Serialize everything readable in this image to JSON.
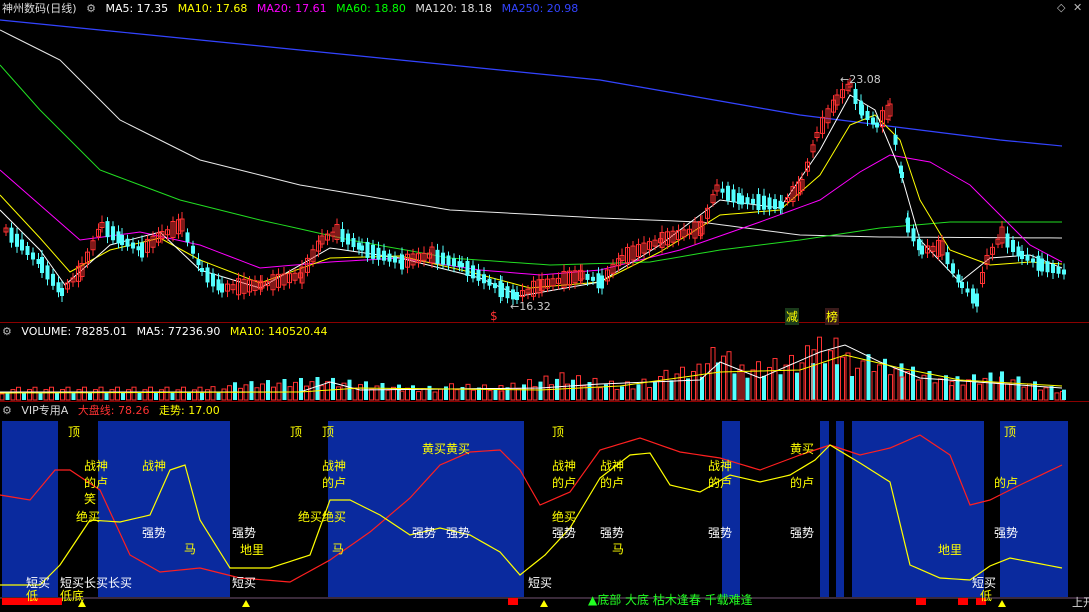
{
  "header": {
    "title": "神州数码(日线)",
    "ma": [
      {
        "label": "MA5: 17.35",
        "color": "#ffffff"
      },
      {
        "label": "MA10: 17.68",
        "color": "#ffff00"
      },
      {
        "label": "MA20: 17.61",
        "color": "#ff00ff"
      },
      {
        "label": "MA60: 18.80",
        "color": "#00ff00"
      },
      {
        "label": "MA120: 18.18",
        "color": "#dddddd"
      },
      {
        "label": "MA250: 20.98",
        "color": "#3344ff"
      }
    ]
  },
  "price_panel": {
    "high_label": "23.08",
    "low_label": "16.32",
    "markers": [
      "$",
      "减",
      "榜"
    ]
  },
  "volume_panel": {
    "label": "VOLUME: 78285.01",
    "ma5": "MA5: 77236.90",
    "ma10": "MA10: 140520.44"
  },
  "vip_panel": {
    "name": "VIP专用A",
    "dapan": "大盘线: 78.26",
    "zoushi": "走势: 17.00",
    "bottom_text": "▲底部 大底 枯木逢春 千载难逢",
    "corner": "上开"
  },
  "colors": {
    "up": "#ff3232",
    "down": "#54ffff",
    "blue_band": "#0a2a9e"
  },
  "chart_data": {
    "type": "candlestick",
    "stock": "神州数码",
    "period": "日线",
    "y_range": [
      16.0,
      24.0
    ],
    "high": 23.08,
    "low": 16.32
  }
}
